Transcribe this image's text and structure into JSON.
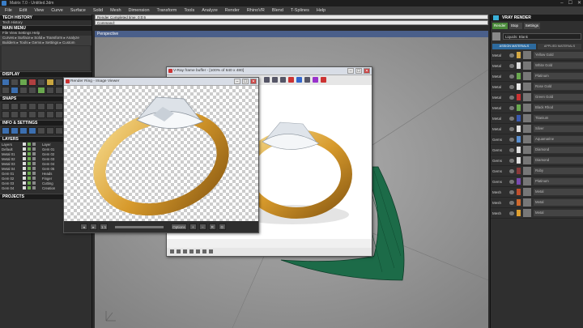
{
  "app": {
    "title": "Matrix 7.0 - Untitled.3dm",
    "window_controls": [
      "–",
      "☐",
      "✕"
    ]
  },
  "menubar": {
    "items": [
      "File",
      "Edit",
      "View",
      "Curve",
      "Surface",
      "Solid",
      "Mesh",
      "Dimension",
      "Transform",
      "Tools",
      "Analyze",
      "Render",
      "RhinoVR",
      "Blend",
      "T-Splines",
      "Help"
    ]
  },
  "left_panel": {
    "sections": [
      {
        "title": "TECH HISTORY",
        "rows": [
          "Tech History"
        ]
      },
      {
        "title": "MAIN MENU",
        "rows": [
          "File  View  Settings  Help",
          "Curves ▸ Surface ▸ Solid ▸ Transform ▸ Analyze",
          "Builders ▸ Tools ▸ Gems ▸ Settings ▸ Custom"
        ]
      }
    ],
    "display_title": "DISPLAY",
    "snaps_title": "SNAPS",
    "info_title": "INFO & SETTINGS",
    "layers_title": "LAYERS",
    "layers": [
      {
        "name": "Layers",
        "right": "Layer"
      },
      {
        "name": "Default",
        "right": "Gem 01"
      },
      {
        "name": "Metal 01",
        "right": "Gem 02"
      },
      {
        "name": "Metal 02",
        "right": "Gem 03"
      },
      {
        "name": "Metal 03",
        "right": "Gem 04"
      },
      {
        "name": "Metal 04",
        "right": "Gem 05"
      },
      {
        "name": "Gem 01",
        "right": "Heads"
      },
      {
        "name": "Gem 02",
        "right": "Finger"
      },
      {
        "name": "Gem 03",
        "right": "Cutting"
      },
      {
        "name": "Gem 04",
        "right": "Creation"
      }
    ],
    "projects_title": "PROJECTS"
  },
  "command": {
    "line1": "Render Completed time: 0:0:6",
    "line2": "Command:",
    "viewport_label": "Perspective"
  },
  "vfb_window": {
    "title": "V-Ray frame buffer - [100% of 640 x 480]"
  },
  "preview_window": {
    "title": "Render Ring - Image Viewer",
    "controls": [
      "◂",
      "▸",
      "1:1",
      "Options",
      "+",
      "–",
      "R",
      "G"
    ]
  },
  "right_panel": {
    "title": "VRAY RENDER",
    "top_buttons": [
      "Render",
      "Stop",
      "Settings"
    ],
    "material_select": "Liquids: Blank",
    "tabs": [
      "ASSIGN MATERIALS",
      "APPLIED MATERIALS"
    ],
    "materials": [
      {
        "name": "Metal",
        "color": "#d4a843",
        "label": "Yellow Gold"
      },
      {
        "name": "Metal",
        "color": "#e0e0e0",
        "label": "White Gold"
      },
      {
        "name": "Metal",
        "color": "#6aa84f",
        "label": "Platinum"
      },
      {
        "name": "Metal",
        "color": "#e8e8e8",
        "label": "Rose Gold"
      },
      {
        "name": "Metal",
        "color": "#cc3333",
        "label": "Green Gold"
      },
      {
        "name": "Metal",
        "color": "#6aa84f",
        "label": "Black Rhod"
      },
      {
        "name": "Metal",
        "color": "#3a5ab0",
        "label": "Titanium"
      },
      {
        "name": "Metal",
        "color": "#e0e0e0",
        "label": "Silver"
      },
      {
        "name": "Gems",
        "color": "#5a8fd0",
        "label": "Aquamarine"
      },
      {
        "name": "Gems",
        "color": "#e0e0e0",
        "label": "Diamond"
      },
      {
        "name": "Gems",
        "color": "#e0e0e0",
        "label": "Diamond"
      },
      {
        "name": "Gems",
        "color": "#8a3a3a",
        "label": "Ruby"
      },
      {
        "name": "Gems",
        "color": "#7a4ab0",
        "label": "Platinum"
      },
      {
        "name": "Mesh",
        "color": "#c0502e",
        "label": "Metal"
      },
      {
        "name": "Mesh",
        "color": "#d06a2e",
        "label": "Metal"
      },
      {
        "name": "Mesh",
        "color": "#e0a030",
        "label": "Metal"
      }
    ]
  }
}
